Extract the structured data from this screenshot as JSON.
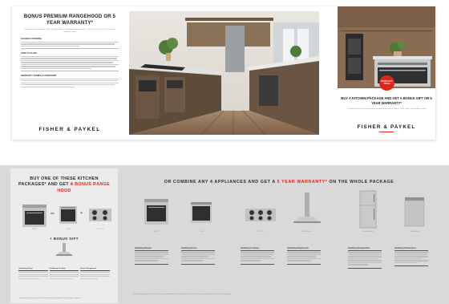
{
  "front": {
    "promo_title": "BONUS PREMIUM RANGEHOOD OR 5 YEAR WARRANTY*",
    "promo_sub": "When you buy a qualifying Fisher & Paykel Kitchen package between January 1 2023 and June 30 2023. Terms and conditions apply.",
    "sections": [
      {
        "heading": "ELIGIBLE OFFERING",
        "lines": 3
      },
      {
        "heading": "HOW TO CLAIM",
        "lines": 7
      },
      {
        "heading": "WARRANTY TERMS & CONDITIONS",
        "lines": 5
      }
    ],
    "brand": "FISHER & PAYKEL",
    "right_title": "BUY A KITCHEN PACKAGE AND GET A BONUS GIFT OR 5 YEAR WARRANTY*",
    "right_text": "*On qualifying Fisher & Paykel kitchen appliance purchases made in 2023. Terms and conditions apply.",
    "seal_text": "BONUS GIFT OFFER"
  },
  "inside": {
    "left_title_1": "BUY ONE OF THESE KITCHEN PACKAGES* AND GET",
    "left_title_2": "A BONUS RANGE HOOD",
    "op_or": "OR",
    "op_plus": "+",
    "gift_label": "+ BONUS GIFT",
    "prod_caps": [
      "RANGE",
      "OVEN",
      "COOKTOP"
    ],
    "table_headers": [
      "Qualifying Range",
      "Qualifying Package",
      "Bonus Rangehood"
    ],
    "footer_left": "*Qualifying products only. Terms and conditions apply. See back page for details.",
    "right_title_1": "OR COMBINE ANY 4 APPLIANCES AND GET A ",
    "right_title_2": "5 YEAR WARRANTY*",
    "right_title_3": " ON THE WHOLE PACKAGE",
    "products": [
      {
        "caption": "RANGE"
      },
      {
        "caption": "OVEN"
      },
      {
        "caption": "COOKTOP"
      },
      {
        "caption": "RANGEHOOD"
      },
      {
        "caption": "REFRIGERATION"
      },
      {
        "caption": "DISHWASHER"
      }
    ],
    "spec_heads": [
      "Qualifying Ranges",
      "Qualifying Ovens",
      "Qualifying Cooktops",
      "Qualifying Rangehoods",
      "Qualifying Refrigeration",
      "Qualifying Dishwashers"
    ],
    "footer_right": "*Qualifying products only. See terms and conditions for full details of the extended 5 year warranty offer on the whole package."
  }
}
